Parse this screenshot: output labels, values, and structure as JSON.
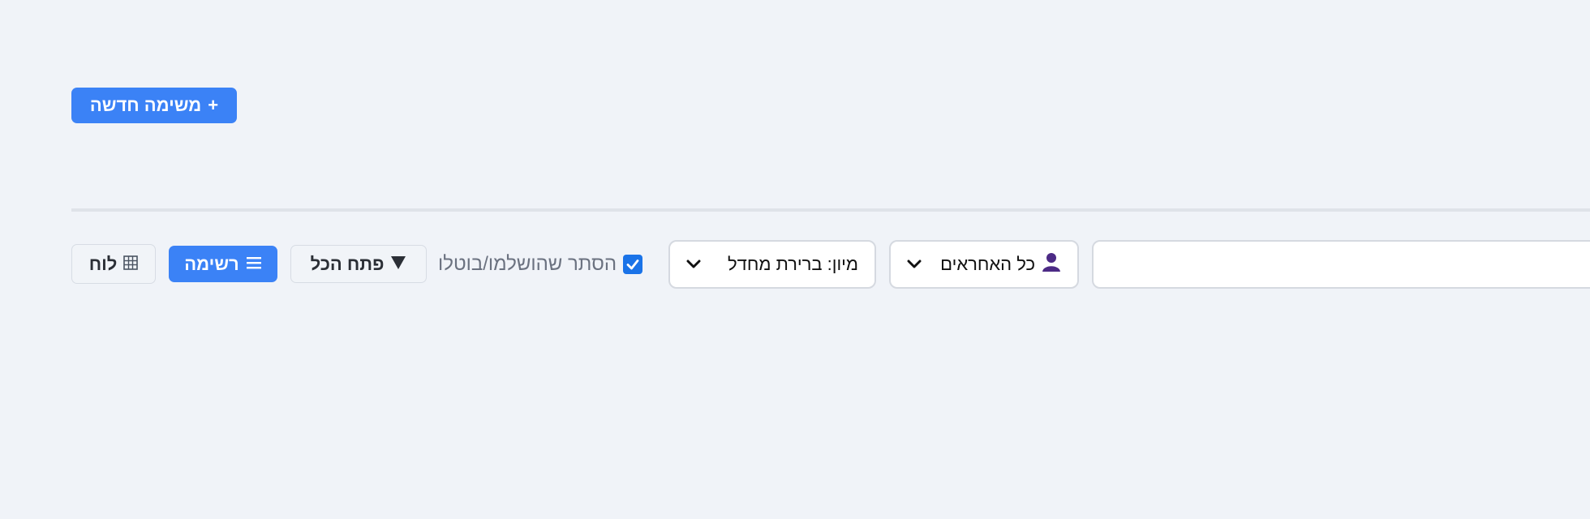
{
  "header": {
    "new_task_label": "משימה חדשה",
    "new_task_plus": "+"
  },
  "toolbar": {
    "board_label": "לוח",
    "board_icon": "grid-icon",
    "list_label": "רשימה",
    "list_icon": "list-icon",
    "expand_all_label": "פתח הכל",
    "expand_icon": "triangle-down-icon",
    "hide_done_label": "הסתר שהושלמו/בוטלו",
    "hide_done_checked": true,
    "sort_select_value": "מיון: ברירת מחדל",
    "owner_select_value": "כל האחראים",
    "owner_icon": "person-icon",
    "search_value": ""
  },
  "colors": {
    "primary": "#3b82f6",
    "background": "#f0f3f8",
    "checkbox": "#1a73e8",
    "person_icon": "#4c2a85"
  }
}
